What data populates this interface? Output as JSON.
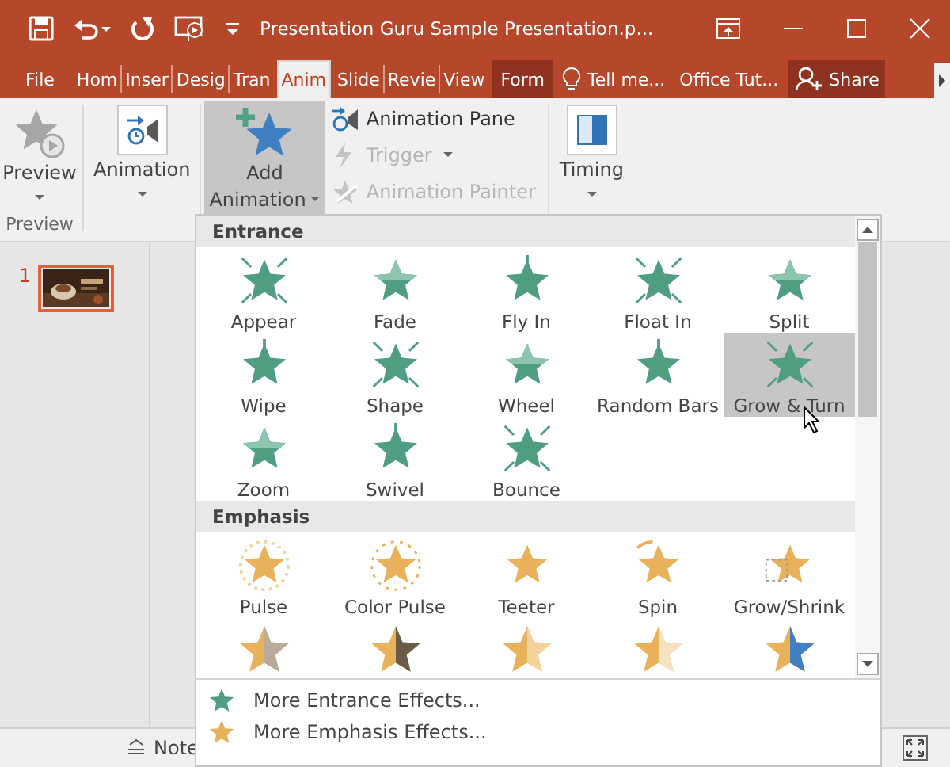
{
  "window": {
    "title": "Presentation Guru Sample Presentation.p..."
  },
  "tabs": [
    {
      "label": "File",
      "selected": false,
      "kind": "file"
    },
    {
      "label": "Hom",
      "selected": false,
      "kind": "tab"
    },
    {
      "label": "Inser",
      "selected": false,
      "kind": "tab"
    },
    {
      "label": "Desig",
      "selected": false,
      "kind": "tab"
    },
    {
      "label": "Tran",
      "selected": false,
      "kind": "tab"
    },
    {
      "label": "Anim",
      "selected": true,
      "kind": "tab"
    },
    {
      "label": "Slide",
      "selected": false,
      "kind": "tab"
    },
    {
      "label": "Revie",
      "selected": false,
      "kind": "tab"
    },
    {
      "label": "View",
      "selected": false,
      "kind": "tab"
    },
    {
      "label": "Form",
      "selected": false,
      "kind": "context"
    },
    {
      "label": "Tell me...",
      "selected": false,
      "kind": "tell"
    },
    {
      "label": "Office Tut...",
      "selected": false,
      "kind": "plain"
    },
    {
      "label": "Share",
      "selected": false,
      "kind": "share"
    }
  ],
  "ribbon": {
    "preview": {
      "label": "Preview",
      "group": "Preview"
    },
    "animation": {
      "label": "Animation"
    },
    "add_animation": {
      "label_1": "Add",
      "label_2": "Animation",
      "highlighted": true
    },
    "small_buttons": [
      {
        "label": "Animation Pane",
        "disabled": false,
        "kind": "pane"
      },
      {
        "label": "Trigger",
        "disabled": true,
        "kind": "trigger"
      },
      {
        "label": "Animation Painter",
        "disabled": true,
        "kind": "painter"
      }
    ],
    "timing": {
      "label": "Timing"
    }
  },
  "slides": [
    {
      "number": "1",
      "selected": true
    }
  ],
  "status_bar": {
    "notes": "Note"
  },
  "gallery": {
    "sections": [
      {
        "title": "Entrance",
        "kind": "entrance",
        "items": [
          {
            "label": "Appear",
            "selected": false
          },
          {
            "label": "Fade",
            "selected": false
          },
          {
            "label": "Fly In",
            "selected": false
          },
          {
            "label": "Float In",
            "selected": false
          },
          {
            "label": "Split",
            "selected": false
          },
          {
            "label": "Wipe",
            "selected": false
          },
          {
            "label": "Shape",
            "selected": false
          },
          {
            "label": "Wheel",
            "selected": false
          },
          {
            "label": "Random Bars",
            "selected": false
          },
          {
            "label": "Grow & Turn",
            "selected": true
          },
          {
            "label": "Zoom",
            "selected": false
          },
          {
            "label": "Swivel",
            "selected": false
          },
          {
            "label": "Bounce",
            "selected": false
          }
        ]
      },
      {
        "title": "Emphasis",
        "kind": "emphasis",
        "items": [
          {
            "label": "Pulse",
            "selected": false
          },
          {
            "label": "Color Pulse",
            "selected": false
          },
          {
            "label": "Teeter",
            "selected": false
          },
          {
            "label": "Spin",
            "selected": false
          },
          {
            "label": "Grow/Shrink",
            "selected": false
          },
          {
            "selected": false
          },
          {
            "selected": false
          },
          {
            "selected": false
          },
          {
            "selected": false
          },
          {
            "selected": false
          }
        ]
      }
    ],
    "more": [
      {
        "label": "More Entrance Effects...",
        "kind": "entrance"
      },
      {
        "label": "More Emphasis Effects...",
        "kind": "emphasis"
      }
    ]
  }
}
